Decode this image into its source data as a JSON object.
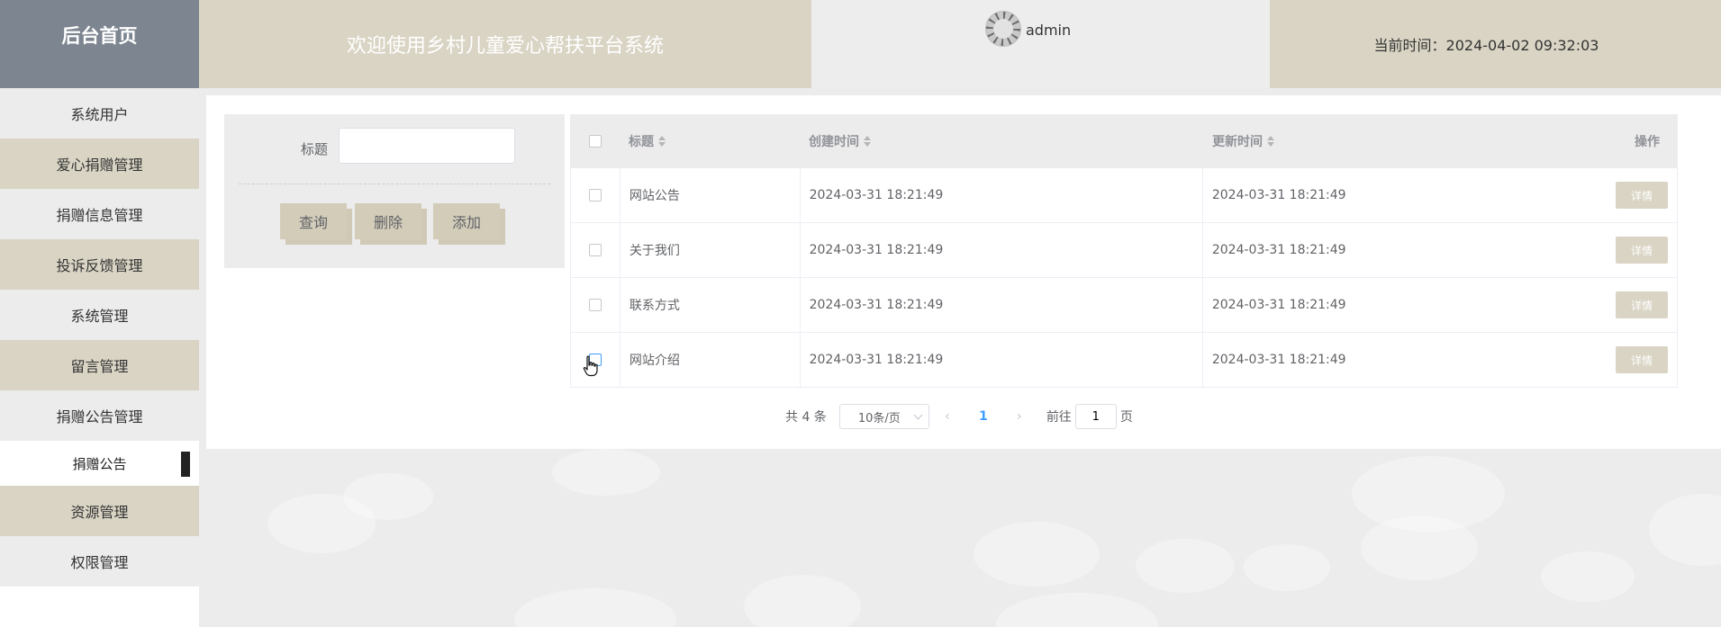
{
  "header": {
    "brand": "后台首页",
    "welcome": "欢迎使用乡村儿童爱心帮扶平台系统",
    "username": "admin",
    "current_time": "当前时间：2024-04-02 09:32:03"
  },
  "sidebar": {
    "items": [
      {
        "label": "系统用户"
      },
      {
        "label": "爱心捐赠管理"
      },
      {
        "label": "捐赠信息管理"
      },
      {
        "label": "投诉反馈管理"
      },
      {
        "label": "系统管理"
      },
      {
        "label": "留言管理"
      },
      {
        "label": "捐赠公告管理"
      }
    ],
    "active_sub": "捐赠公告",
    "items_after": [
      {
        "label": "资源管理"
      },
      {
        "label": "权限管理"
      }
    ]
  },
  "search": {
    "title_label": "标题",
    "title_value": "",
    "query_label": "查询",
    "delete_label": "删除",
    "add_label": "添加"
  },
  "table": {
    "headers": [
      "标题",
      "创建时间",
      "更新时间",
      "操作"
    ],
    "rows": [
      {
        "title": "网站公告",
        "created": "2024-03-31 18:21:49",
        "updated": "2024-03-31 18:21:49",
        "action": "详情"
      },
      {
        "title": "关于我们",
        "created": "2024-03-31 18:21:49",
        "updated": "2024-03-31 18:21:49",
        "action": "详情"
      },
      {
        "title": "联系方式",
        "created": "2024-03-31 18:21:49",
        "updated": "2024-03-31 18:21:49",
        "action": "详情"
      },
      {
        "title": "网站介绍",
        "created": "2024-03-31 18:21:49",
        "updated": "2024-03-31 18:21:49",
        "action": "详情"
      }
    ]
  },
  "pagination": {
    "total": "共 4 条",
    "page_size": "10条/页",
    "current_page": "1",
    "goto_prefix": "前往",
    "goto_value": "1",
    "goto_suffix": "页"
  }
}
